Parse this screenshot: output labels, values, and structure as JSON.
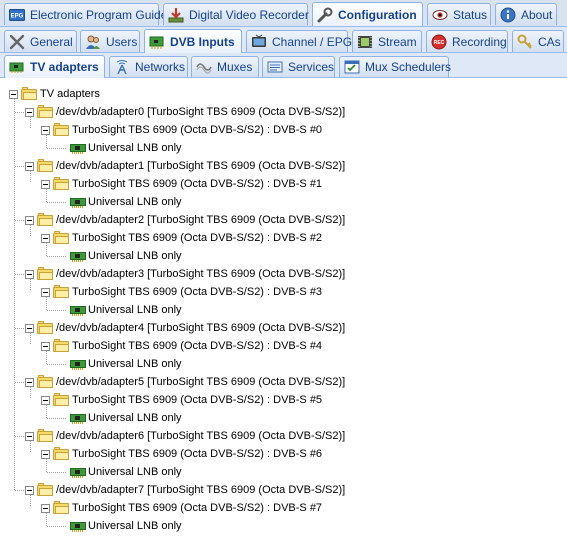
{
  "main_tabs": [
    {
      "label": "Electronic Program Guide",
      "icon": "epg-icon"
    },
    {
      "label": "Digital Video Recorder",
      "icon": "download-icon"
    },
    {
      "label": "Configuration",
      "icon": "wrench-icon",
      "active": true
    },
    {
      "label": "Status",
      "icon": "eye-icon"
    },
    {
      "label": "About",
      "icon": "info-icon"
    }
  ],
  "config_tabs": [
    {
      "label": "General",
      "icon": "tools-icon"
    },
    {
      "label": "Users",
      "icon": "users-icon"
    },
    {
      "label": "DVB Inputs",
      "icon": "tv-card-icon",
      "active": true
    },
    {
      "label": "Channel / EPG",
      "icon": "television-icon"
    },
    {
      "label": "Stream",
      "icon": "film-icon"
    },
    {
      "label": "Recording",
      "icon": "rec-icon"
    },
    {
      "label": "CAs",
      "icon": "key-icon"
    }
  ],
  "dvb_tabs": [
    {
      "label": "TV adapters",
      "icon": "adapter-icon",
      "active": true
    },
    {
      "label": "Networks",
      "icon": "antenna-icon"
    },
    {
      "label": "Muxes",
      "icon": "mux-icon"
    },
    {
      "label": "Services",
      "icon": "services-icon"
    },
    {
      "label": "Mux Schedulers",
      "icon": "scheduler-icon"
    }
  ],
  "tree": {
    "root_label": "TV adapters",
    "adapters": [
      {
        "label": "/dev/dvb/adapter0 [TurboSight TBS 6909 (Octa DVB-S/S2)]",
        "frontend": "TurboSight TBS 6909 (Octa DVB-S/S2) : DVB-S #0",
        "lnb": "Universal LNB only"
      },
      {
        "label": "/dev/dvb/adapter1 [TurboSight TBS 6909 (Octa DVB-S/S2)]",
        "frontend": "TurboSight TBS 6909 (Octa DVB-S/S2) : DVB-S #1",
        "lnb": "Universal LNB only"
      },
      {
        "label": "/dev/dvb/adapter2 [TurboSight TBS 6909 (Octa DVB-S/S2)]",
        "frontend": "TurboSight TBS 6909 (Octa DVB-S/S2) : DVB-S #2",
        "lnb": "Universal LNB only"
      },
      {
        "label": "/dev/dvb/adapter3 [TurboSight TBS 6909 (Octa DVB-S/S2)]",
        "frontend": "TurboSight TBS 6909 (Octa DVB-S/S2) : DVB-S #3",
        "lnb": "Universal LNB only"
      },
      {
        "label": "/dev/dvb/adapter4 [TurboSight TBS 6909 (Octa DVB-S/S2)]",
        "frontend": "TurboSight TBS 6909 (Octa DVB-S/S2) : DVB-S #4",
        "lnb": "Universal LNB only"
      },
      {
        "label": "/dev/dvb/adapter5 [TurboSight TBS 6909 (Octa DVB-S/S2)]",
        "frontend": "TurboSight TBS 6909 (Octa DVB-S/S2) : DVB-S #5",
        "lnb": "Universal LNB only"
      },
      {
        "label": "/dev/dvb/adapter6 [TurboSight TBS 6909 (Octa DVB-S/S2)]",
        "frontend": "TurboSight TBS 6909 (Octa DVB-S/S2) : DVB-S #6",
        "lnb": "Universal LNB only"
      },
      {
        "label": "/dev/dvb/adapter7 [TurboSight TBS 6909 (Octa DVB-S/S2)]",
        "frontend": "TurboSight TBS 6909 (Octa DVB-S/S2) : DVB-S #7",
        "lnb": "Universal LNB only"
      }
    ]
  },
  "colors": {
    "tab_text": "#15428b",
    "tab_border": "#8db2e3",
    "strip": "#dfe8f6",
    "folder": "#f6d96b"
  }
}
